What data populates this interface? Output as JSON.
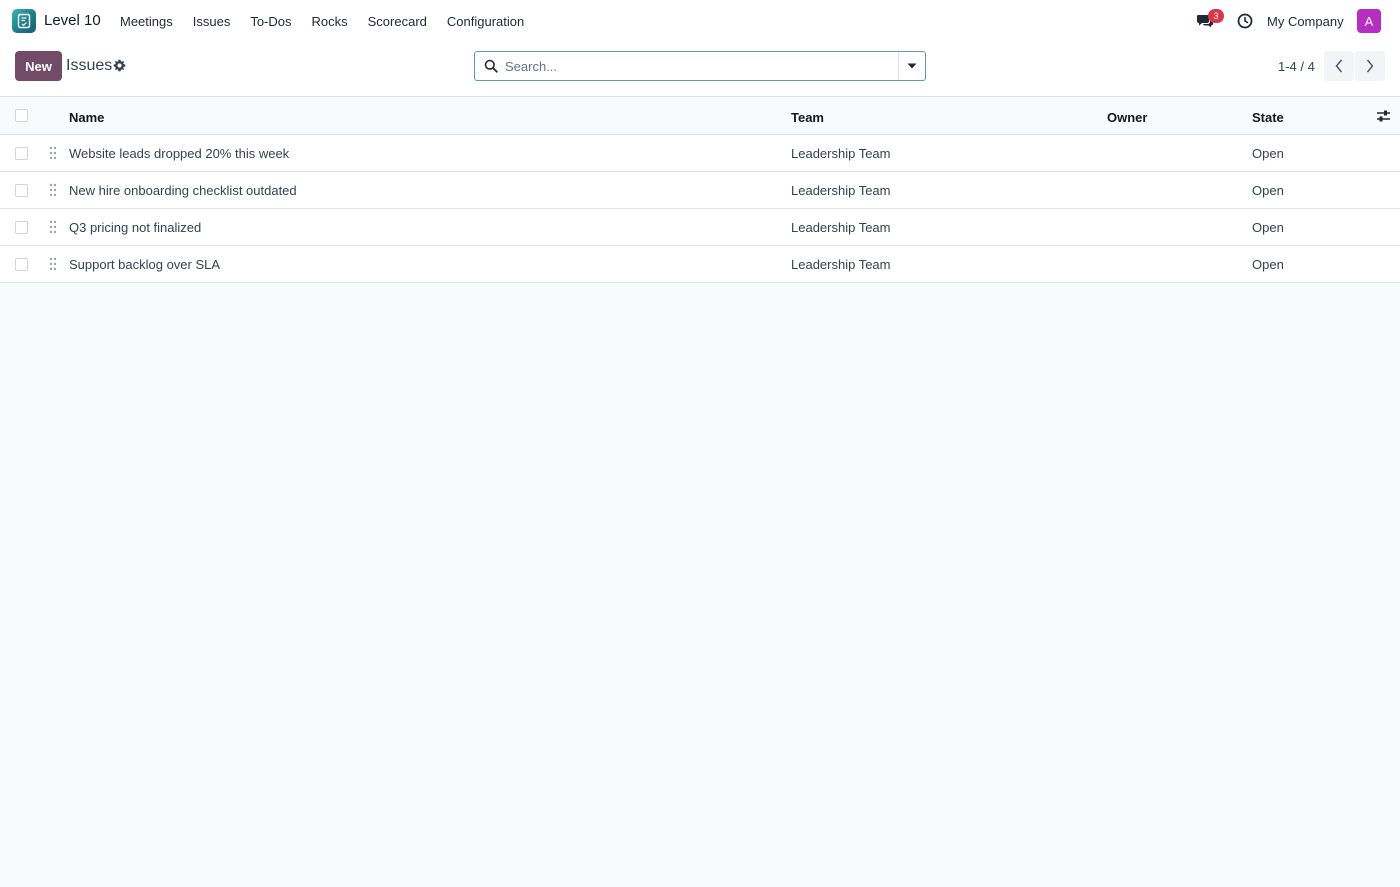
{
  "navbar": {
    "app_name": "Level 10",
    "menu": [
      {
        "label": "Meetings"
      },
      {
        "label": "Issues"
      },
      {
        "label": "To-Dos"
      },
      {
        "label": "Rocks"
      },
      {
        "label": "Scorecard"
      },
      {
        "label": "Configuration"
      }
    ],
    "chat_badge_count": "3",
    "company_name": "My Company",
    "avatar_initial": "A",
    "icons": [
      "app-logo-icon",
      "chat-icon",
      "clock-icon"
    ],
    "colors": {
      "avatar": "#b62ec0",
      "badge": "#dc3545",
      "logo": "#1d7c8c"
    }
  },
  "control_panel": {
    "new_button_label": "New",
    "breadcrumb_title": "Issues",
    "search_placeholder": "Search...",
    "pager_value": "1-4 / 4",
    "colors": {
      "primary": "#714b67"
    }
  },
  "table": {
    "columns": [
      {
        "label": "Name"
      },
      {
        "label": "Team"
      },
      {
        "label": "Owner"
      },
      {
        "label": "State"
      }
    ],
    "rows": [
      {
        "name": "Website leads dropped 20% this week",
        "team": "Leadership Team",
        "owner": "",
        "state": "Open"
      },
      {
        "name": "New hire onboarding checklist outdated",
        "team": "Leadership Team",
        "owner": "",
        "state": "Open"
      },
      {
        "name": "Q3 pricing not finalized",
        "team": "Leadership Team",
        "owner": "",
        "state": "Open"
      },
      {
        "name": "Support backlog over SLA",
        "team": "Leadership Team",
        "owner": "",
        "state": "Open"
      }
    ]
  }
}
